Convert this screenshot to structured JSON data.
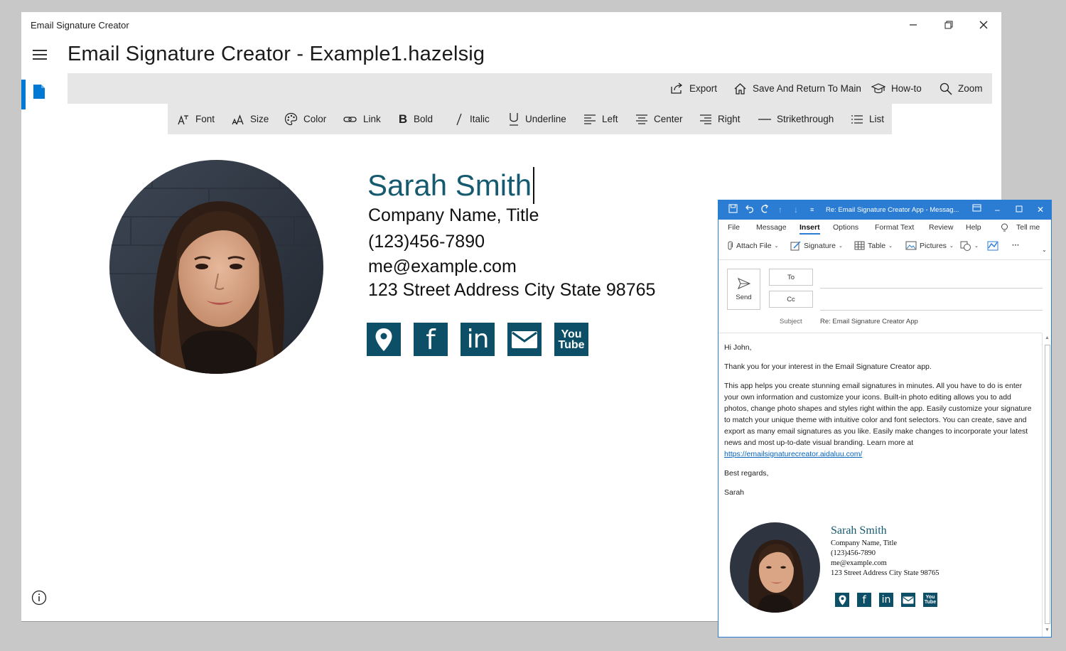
{
  "app": {
    "window_title": "Email Signature Creator",
    "doc_title": "Email Signature Creator - Example1.hazelsig"
  },
  "toolbar_top": [
    {
      "label": "Export",
      "icon": "export-icon"
    },
    {
      "label": "Save And Return To Main",
      "icon": "home-icon"
    },
    {
      "label": "How-to",
      "icon": "graduation-cap-icon"
    },
    {
      "label": "Zoom",
      "icon": "magnifier-icon"
    }
  ],
  "toolbar_format": [
    {
      "label": "Font",
      "icon": "font-icon"
    },
    {
      "label": "Size",
      "icon": "font-size-icon"
    },
    {
      "label": "Color",
      "icon": "palette-icon"
    },
    {
      "label": "Link",
      "icon": "link-icon"
    },
    {
      "label": "Bold",
      "icon": "bold-icon"
    },
    {
      "label": "Italic",
      "icon": "italic-icon"
    },
    {
      "label": "Underline",
      "icon": "underline-icon"
    },
    {
      "label": "Left",
      "icon": "align-left-icon"
    },
    {
      "label": "Center",
      "icon": "align-center-icon"
    },
    {
      "label": "Right",
      "icon": "align-right-icon"
    },
    {
      "label": "Strikethrough",
      "icon": "strikethrough-icon"
    },
    {
      "label": "List",
      "icon": "list-icon"
    }
  ],
  "signature": {
    "name": "Sarah Smith",
    "company": "Company Name, Title",
    "phone": "(123)456-7890",
    "email": "me@example.com",
    "address": "123 Street Address City State 98765",
    "social": {
      "location": "location-pin-icon",
      "facebook": "f",
      "linkedin": "in",
      "mail": "envelope-icon",
      "youtube_top": "You",
      "youtube_bottom": "Tube"
    },
    "brand_color": "#0d4f66",
    "name_color": "#155a6e"
  },
  "outlook": {
    "title": "Re: Email Signature Creator App  -  Messag...",
    "menu": [
      "File",
      "Message",
      "Insert",
      "Options",
      "Format Text",
      "Review",
      "Help",
      "Tell me"
    ],
    "active_menu": "Insert",
    "ribbon": {
      "attach": "Attach File",
      "signature": "Signature",
      "table": "Table",
      "pictures": "Pictures"
    },
    "send": "Send",
    "to": "To",
    "cc": "Cc",
    "subject_label": "Subject",
    "subject_value": "Re: Email Signature Creator App",
    "body": {
      "greeting": "Hi John,",
      "p1": "Thank you for your interest in the Email Signature Creator app.",
      "p2": "This app helps you create stunning email signatures in minutes.  All you have to do is enter your own information and customize your icons.  Built-in photo editing allows you to add photos, change photo shapes and styles right within the app.  Easily customize your signature to match your unique theme with intuitive color and font selectors.  You can create, save and export as many email signatures as you like.  Easily make changes to incorporate your latest news and most up-to-date visual branding.",
      "learn_more": "Learn more at ",
      "link": "https://emailsignaturecreator.aidaluu.com/",
      "closing": "Best regards,",
      "sender": "Sarah"
    },
    "accent_color": "#2b7cd3"
  }
}
